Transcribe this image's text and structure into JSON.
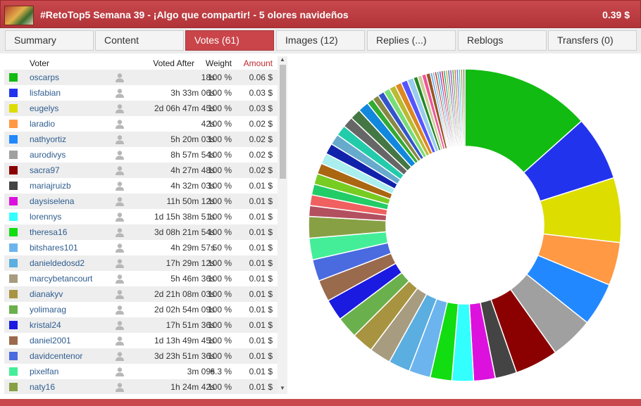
{
  "header": {
    "title": "#RetoTop5 Semana 39 - ¡Algo que compartir! - 5 olores navideños",
    "payout": "0.39 $"
  },
  "tabs": [
    {
      "label": "Summary"
    },
    {
      "label": "Content"
    },
    {
      "label": "Votes (61)"
    },
    {
      "label": "Images (12)"
    },
    {
      "label": "Replies (...)"
    },
    {
      "label": "Reblogs"
    },
    {
      "label": "Transfers (0)"
    }
  ],
  "active_tab": "Votes (61)",
  "table": {
    "headers": {
      "voter": "Voter",
      "voted_after": "Voted After",
      "weight": "Weight",
      "amount": "Amount"
    },
    "rows": [
      {
        "voter": "oscarps",
        "voted_after": "18s",
        "weight": "100 %",
        "amount": "0.06 $",
        "color": "#11bb11"
      },
      {
        "voter": "lisfabian",
        "voted_after": "3h 33m 06s",
        "weight": "100 %",
        "amount": "0.03 $",
        "color": "#2233ee"
      },
      {
        "voter": "eugelys",
        "voted_after": "2d 06h 47m 45s",
        "weight": "100 %",
        "amount": "0.03 $",
        "color": "#dddd00"
      },
      {
        "voter": "laradio",
        "voted_after": "42s",
        "weight": "100 %",
        "amount": "0.02 $",
        "color": "#ff9944"
      },
      {
        "voter": "nathyortiz",
        "voted_after": "5h 20m 03s",
        "weight": "100 %",
        "amount": "0.02 $",
        "color": "#2288ff"
      },
      {
        "voter": "aurodivys",
        "voted_after": "8h 57m 54s",
        "weight": "100 %",
        "amount": "0.02 $",
        "color": "#a0a0a0"
      },
      {
        "voter": "sacra97",
        "voted_after": "4h 27m 48s",
        "weight": "100 %",
        "amount": "0.02 $",
        "color": "#8b0000"
      },
      {
        "voter": "mariajruizb",
        "voted_after": "4h 32m 03s",
        "weight": "100 %",
        "amount": "0.01 $",
        "color": "#444444"
      },
      {
        "voter": "daysiselena",
        "voted_after": "11h 50m 12s",
        "weight": "100 %",
        "amount": "0.01 $",
        "color": "#dd11dd"
      },
      {
        "voter": "lorennys",
        "voted_after": "1d 15h 38m 51s",
        "weight": "100 %",
        "amount": "0.01 $",
        "color": "#33ffff"
      },
      {
        "voter": "theresa16",
        "voted_after": "3d 08h 21m 54s",
        "weight": "100 %",
        "amount": "0.01 $",
        "color": "#11dd11"
      },
      {
        "voter": "bitshares101",
        "voted_after": "4h 29m 57s",
        "weight": "50 %",
        "amount": "0.01 $",
        "color": "#6cb4ee"
      },
      {
        "voter": "danieldedosd2",
        "voted_after": "17h 29m 12s",
        "weight": "100 %",
        "amount": "0.01 $",
        "color": "#5aaee0"
      },
      {
        "voter": "marcybetancourt",
        "voted_after": "5h 46m 36s",
        "weight": "100 %",
        "amount": "0.01 $",
        "color": "#a89c80"
      },
      {
        "voter": "dianakyv",
        "voted_after": "2d 21h 08m 03s",
        "weight": "100 %",
        "amount": "0.01 $",
        "color": "#a89440"
      },
      {
        "voter": "yolimarag",
        "voted_after": "2d 02h 54m 09s",
        "weight": "100 %",
        "amount": "0.01 $",
        "color": "#6ab04c"
      },
      {
        "voter": "kristal24",
        "voted_after": "17h 51m 36s",
        "weight": "100 %",
        "amount": "0.01 $",
        "color": "#1a1ae0"
      },
      {
        "voter": "daniel2001",
        "voted_after": "1d 13h 49m 45s",
        "weight": "100 %",
        "amount": "0.01 $",
        "color": "#9a6a4c"
      },
      {
        "voter": "davidcentenor",
        "voted_after": "3d 23h 51m 36s",
        "weight": "100 %",
        "amount": "0.01 $",
        "color": "#4a6ae0"
      },
      {
        "voter": "pixelfan",
        "voted_after": "3m 09s",
        "weight": "6.3 %",
        "amount": "0.01 $",
        "color": "#44ee99"
      },
      {
        "voter": "naty16",
        "voted_after": "1h 24m 42s",
        "weight": "100 %",
        "amount": "0.01 $",
        "color": "#88a044"
      }
    ]
  },
  "chart_data": {
    "type": "pie",
    "values": [
      0.06,
      0.03,
      0.03,
      0.02,
      0.02,
      0.02,
      0.02,
      0.01,
      0.01,
      0.01,
      0.01,
      0.01,
      0.01,
      0.01,
      0.01,
      0.01,
      0.01,
      0.01,
      0.01,
      0.01,
      0.01,
      0.005,
      0.005,
      0.005,
      0.005,
      0.005,
      0.005,
      0.005,
      0.005,
      0.005,
      0.005,
      0.005,
      0.005,
      0.003,
      0.003,
      0.003,
      0.003,
      0.003,
      0.003,
      0.003,
      0.003,
      0.002,
      0.002,
      0.002,
      0.002,
      0.001,
      0.001,
      0.001,
      0.001,
      0.001,
      0.001,
      0.001,
      0.001,
      0.001,
      0.001,
      0.001,
      0.001,
      0.001,
      0.001,
      0.001,
      0.001
    ],
    "colors": [
      "#11bb11",
      "#2233ee",
      "#dddd00",
      "#ff9944",
      "#2288ff",
      "#a0a0a0",
      "#8b0000",
      "#444444",
      "#dd11dd",
      "#33ffff",
      "#11dd11",
      "#6cb4ee",
      "#5aaee0",
      "#a89c80",
      "#a89440",
      "#6ab04c",
      "#1a1ae0",
      "#9a6a4c",
      "#4a6ae0",
      "#44ee99",
      "#88a044",
      "#b25060",
      "#f06060",
      "#22cc66",
      "#77cc22",
      "#aa6611",
      "#aaeeee",
      "#1122aa",
      "#66aacc",
      "#22ccaa",
      "#666666",
      "#447744",
      "#1188dd",
      "#33aa33",
      "#888844",
      "#3355cc",
      "#77dd77",
      "#bbbb33",
      "#dd8822",
      "#5555ff",
      "#99ccee",
      "#228822",
      "#cccc99",
      "#ee5599",
      "#995522",
      "#4499ff",
      "#aaaaaa",
      "#bb3333",
      "#33bbbb",
      "#8844cc",
      "#dd2222",
      "#22aa88",
      "#ccaa55",
      "#5577aa",
      "#aa55aa",
      "#55aa55",
      "#cc7744",
      "#7777dd",
      "#44cccc",
      "#bb9933",
      "#888888"
    ]
  }
}
